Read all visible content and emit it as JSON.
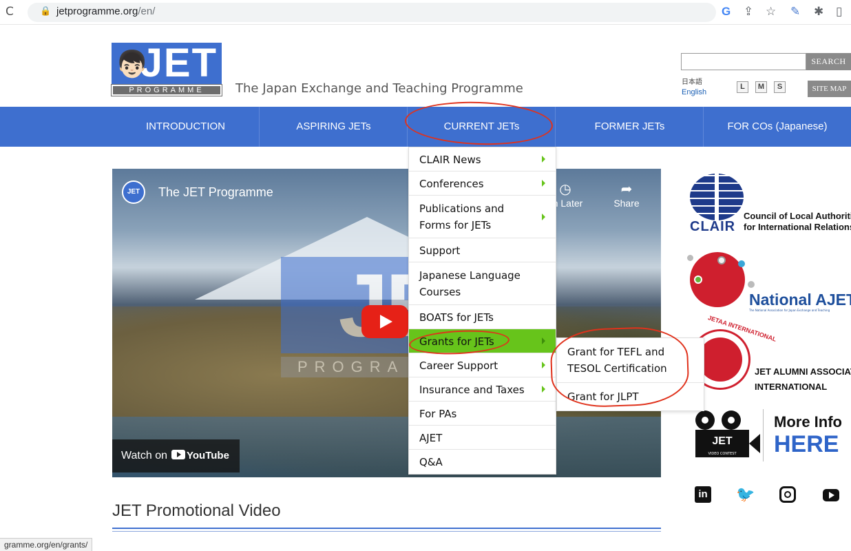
{
  "browser": {
    "url_domain": "jetprogramme.org",
    "url_path": "/en/",
    "reload_icon": "C",
    "toolbar_icons": [
      "google-icon",
      "share-icon",
      "star-icon",
      "extension-icon",
      "puzzle-icon",
      "sidebar-icon"
    ]
  },
  "header": {
    "logo_main": "JET",
    "logo_strip": "PROGRAMME",
    "tagline": "The Japan Exchange and Teaching Programme",
    "search_button": "SEARCH",
    "lang_japanese": "日本語",
    "lang_english": "English",
    "font_sizes": [
      "L",
      "M",
      "S"
    ],
    "sitemap_button": "SITE MAP"
  },
  "nav": {
    "items": [
      "INTRODUCTION",
      "ASPIRING JETs",
      "CURRENT JETs",
      "FORMER JETs",
      "FOR COs (Japanese)"
    ]
  },
  "dropdown": {
    "items": [
      {
        "label": "CLAIR News",
        "has_sub": true
      },
      {
        "label": "Conferences",
        "has_sub": true
      },
      {
        "label": "Publications and Forms for JETs",
        "has_sub": true
      },
      {
        "label": "Support",
        "has_sub": false
      },
      {
        "label": "Japanese Language Courses",
        "has_sub": false
      },
      {
        "label": "BOATS for JETs",
        "has_sub": false
      },
      {
        "label": "Grants for JETs",
        "has_sub": true
      },
      {
        "label": "Career Support",
        "has_sub": true
      },
      {
        "label": "Insurance and Taxes",
        "has_sub": true
      },
      {
        "label": "For PAs",
        "has_sub": false
      },
      {
        "label": "AJET",
        "has_sub": false
      },
      {
        "label": "Q&A",
        "has_sub": false
      }
    ],
    "submenu": [
      "Grant for TEFL and TESOL Certification",
      "Grant for JLPT"
    ]
  },
  "video": {
    "title": "The JET Programme",
    "channel_icon_text": "JET",
    "overlay_main": "JET",
    "overlay_strip": "PROGRA",
    "watch_later": "ch Later",
    "share": "Share",
    "watch_on": "Watch on",
    "youtube": "YouTube"
  },
  "content": {
    "promo_title": "JET Promotional Video"
  },
  "sidebar": {
    "clair_word": "CLAIR",
    "clair_line1": "Council of Local Authorities",
    "clair_line2": "for International Relations",
    "ajet_name": "National AJET",
    "ajet_sub": "The National Association for Japan Exchange and Teaching",
    "jetaa_arc": "JETAA INTERNATIONAL",
    "jetaa_line1": "JET ALUMNI ASSOCIATION",
    "jetaa_line2": "INTERNATIONAL",
    "contest_main": "JET",
    "contest_sub": "VIDEO CONTEST",
    "more_info": "More Info",
    "here": "HERE"
  },
  "social": {
    "linkedin": "in",
    "twitter": "🐦"
  },
  "status_bar": {
    "text": "gramme.org/en/grants/"
  },
  "colors": {
    "brand_blue": "#3e6fcf",
    "menu_active_green": "#67c41b",
    "annotation_red": "#e0321c"
  }
}
